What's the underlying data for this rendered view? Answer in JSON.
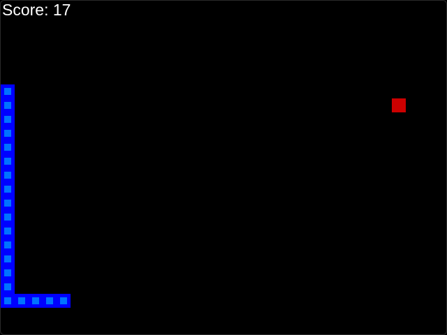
{
  "score": {
    "label": "Score: 17",
    "value": 17
  },
  "colors": {
    "background": "#000000",
    "score_text": "#ffffff",
    "snake_border": "#0000ff",
    "snake_fill": "#0073ff",
    "food": "#cc0000"
  },
  "grid": {
    "cell_size": 20,
    "columns": 32,
    "rows": 24
  },
  "snake": {
    "cells": [
      [
        0,
        6
      ],
      [
        0,
        7
      ],
      [
        0,
        8
      ],
      [
        0,
        9
      ],
      [
        0,
        10
      ],
      [
        0,
        11
      ],
      [
        0,
        12
      ],
      [
        0,
        13
      ],
      [
        0,
        14
      ],
      [
        0,
        15
      ],
      [
        0,
        16
      ],
      [
        0,
        17
      ],
      [
        0,
        18
      ],
      [
        0,
        19
      ],
      [
        0,
        20
      ],
      [
        0,
        21
      ],
      [
        1,
        21
      ],
      [
        2,
        21
      ],
      [
        3,
        21
      ],
      [
        4,
        21
      ]
    ]
  },
  "food": {
    "cell": [
      28,
      7
    ]
  }
}
